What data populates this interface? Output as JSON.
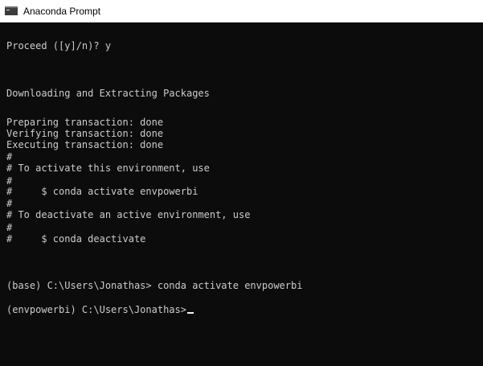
{
  "window": {
    "title": "Anaconda Prompt",
    "icon": "console-icon"
  },
  "console": {
    "lines": [
      "Proceed ([y]/n)? y",
      "Downloading and Extracting Packages",
      "Preparing transaction: done",
      "Verifying transaction: done",
      "Executing transaction: done",
      "#",
      "# To activate this environment, use",
      "#",
      "#     $ conda activate envpowerbi",
      "#",
      "# To deactivate an active environment, use",
      "#",
      "#     $ conda deactivate",
      "(base) C:\\Users\\Jonathas> conda activate envpowerbi",
      "(envpowerbi) C:\\Users\\Jonathas>"
    ]
  }
}
